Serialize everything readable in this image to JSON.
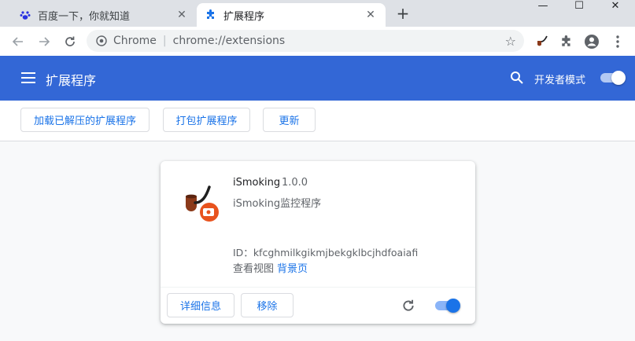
{
  "tabs": [
    {
      "title": "百度一下，你就知道",
      "icon": "baidu-paw-icon",
      "active": false
    },
    {
      "title": "扩展程序",
      "icon": "puzzle-icon",
      "active": true
    }
  ],
  "omnibox": {
    "chip": "Chrome",
    "separator": "|",
    "url": "chrome://extensions"
  },
  "header": {
    "title": "扩展程序",
    "dev_mode_label": "开发者模式",
    "dev_mode_on": true
  },
  "subheader": {
    "load_unpacked": "加载已解压的扩展程序",
    "pack": "打包扩展程序",
    "update": "更新"
  },
  "extension": {
    "name": "iSmoking",
    "version": "1.0.0",
    "description": "iSmoking监控程序",
    "id_label": "ID：",
    "id_value": "kfcghmilkgikmjbekgklbcjhdfoaiafi",
    "views_label": "查看视图",
    "views_link": "背景页",
    "details_button": "详细信息",
    "remove_button": "移除",
    "enabled": true
  },
  "colors": {
    "header_bg": "#3367d6",
    "link": "#1a73e8",
    "tab_strip": "#dee1e6"
  }
}
